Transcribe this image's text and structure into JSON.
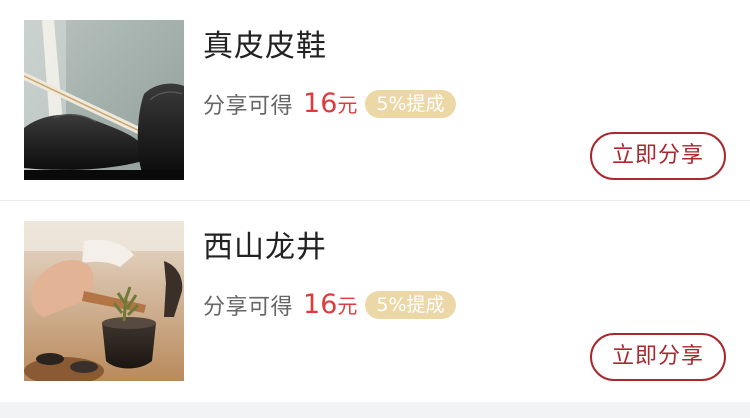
{
  "products": [
    {
      "title": "真皮皮鞋",
      "share_label": "分享可得",
      "amount": "16",
      "unit": "元",
      "badge": "5%提成",
      "button_label": "立即分享",
      "image_icon": "leather-shoes-photo"
    },
    {
      "title": "西山龙井",
      "share_label": "分享可得",
      "amount": "16",
      "unit": "元",
      "badge": "5%提成",
      "button_label": "立即分享",
      "image_icon": "tea-brewing-photo"
    }
  ],
  "colors": {
    "amount": "#e03a3e",
    "badge_bg": "#ecd7a6",
    "button_border": "#a8282e",
    "background": "#f2f3f5"
  }
}
